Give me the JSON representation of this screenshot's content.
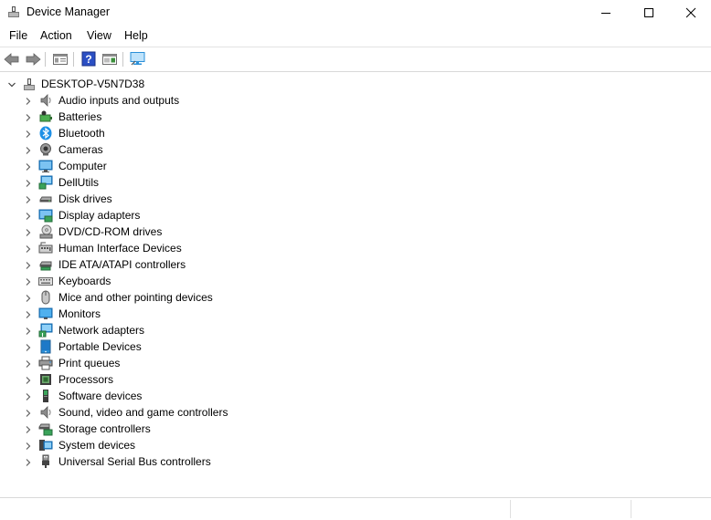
{
  "window": {
    "title": "Device Manager"
  },
  "menu": [
    "File",
    "Action",
    "View",
    "Help"
  ],
  "toolbar": {
    "buttons": [
      "back-arrow-icon",
      "forward-arrow-icon",
      "properties-icon",
      "help-icon",
      "show-hide-console-icon",
      "scan-hardware-icon"
    ]
  },
  "tree": {
    "root": "DESKTOP-V5N7D38",
    "categories": [
      "Audio inputs and outputs",
      "Batteries",
      "Bluetooth",
      "Cameras",
      "Computer",
      "DellUtils",
      "Disk drives",
      "Display adapters",
      "DVD/CD-ROM drives",
      "Human Interface Devices",
      "IDE ATA/ATAPI controllers",
      "Keyboards",
      "Mice and other pointing devices",
      "Monitors",
      "Network adapters",
      "Portable Devices",
      "Print queues",
      "Processors",
      "Software devices",
      "Sound, video and game controllers",
      "Storage controllers",
      "System devices",
      "Universal Serial Bus controllers"
    ]
  },
  "colors": {
    "accent": "#1e90e6",
    "monitor_blue": "#2a8fd8",
    "gray_icon": "#6b6b6b"
  }
}
